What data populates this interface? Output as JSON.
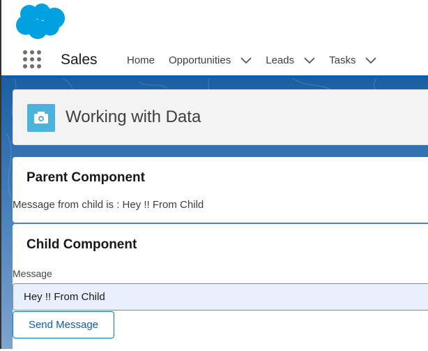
{
  "header": {
    "app_name": "Sales",
    "nav": [
      {
        "label": "Home",
        "dropdown": false
      },
      {
        "label": "Opportunities",
        "dropdown": true
      },
      {
        "label": "Leads",
        "dropdown": true
      },
      {
        "label": "Tasks",
        "dropdown": true
      }
    ]
  },
  "page_header": {
    "title": "Working with Data",
    "icon": "camera-icon"
  },
  "parent": {
    "title": "Parent Component",
    "message": "Message from child is : Hey !! From Child"
  },
  "child": {
    "title": "Child Component",
    "field_label": "Message",
    "field_value": "Hey !! From Child",
    "button_label": "Send Message"
  },
  "colors": {
    "brand": "#00a1e0",
    "accent": "#0b5cab",
    "icon_bg": "#4bb3dc"
  }
}
